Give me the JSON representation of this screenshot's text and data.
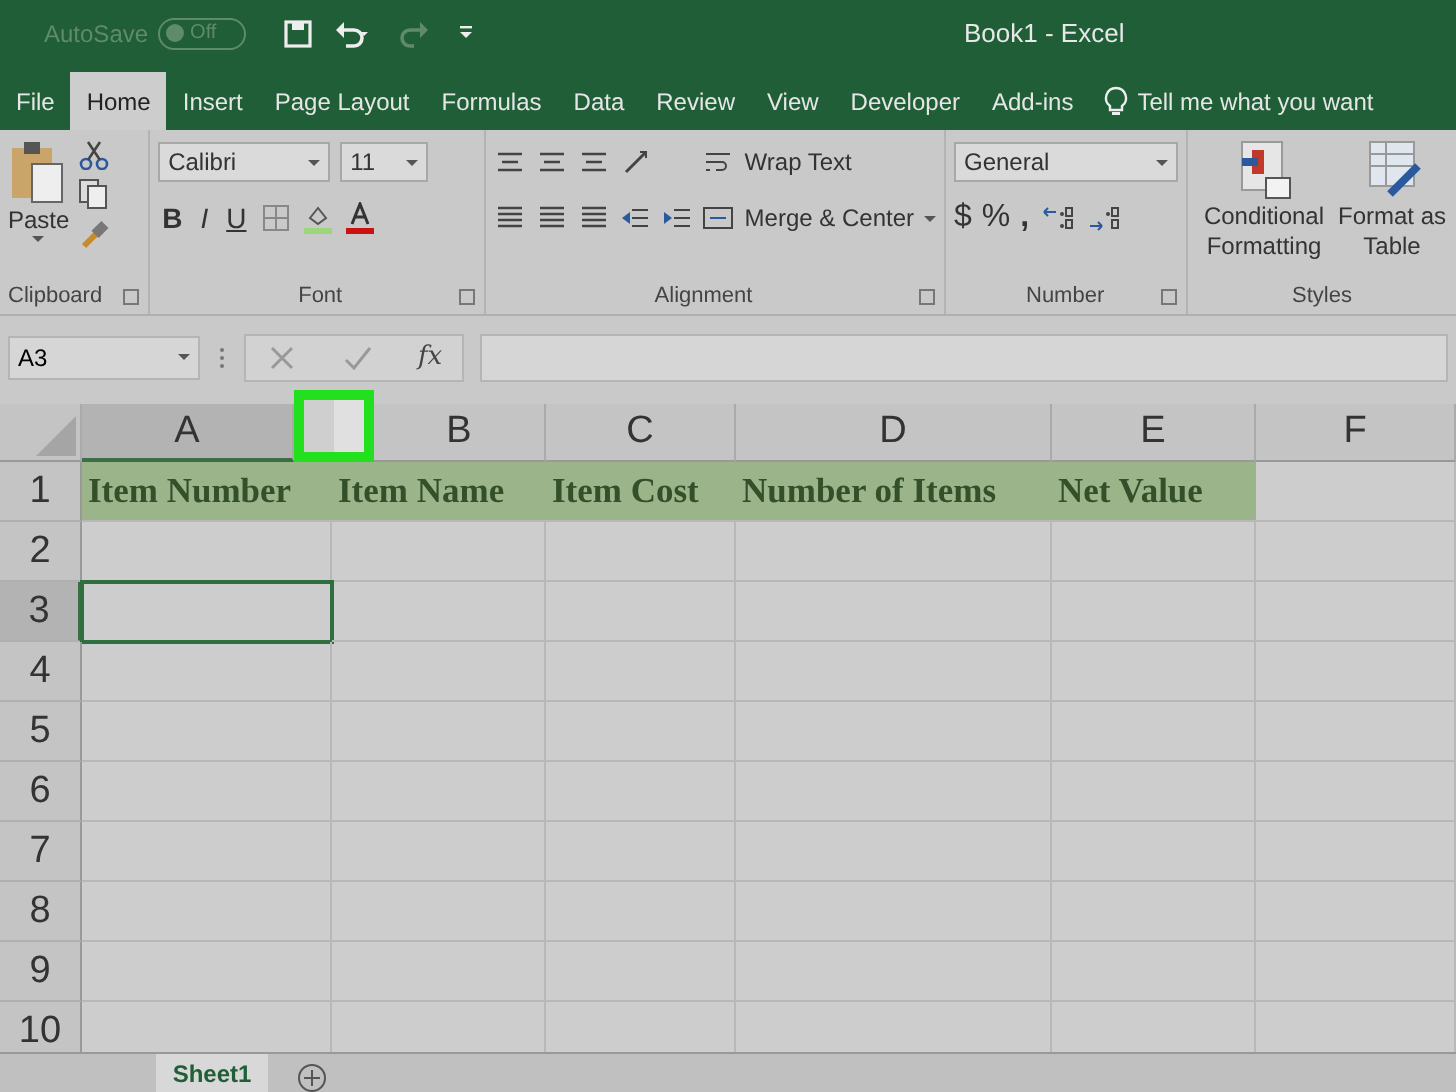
{
  "title_bar": {
    "autosave_label": "AutoSave",
    "autosave_toggle": {
      "label": "Off",
      "on": false
    },
    "title": "Book1  -  Excel"
  },
  "tabs": [
    {
      "label": "File",
      "selected": false
    },
    {
      "label": "Home",
      "selected": true
    },
    {
      "label": "Insert",
      "selected": false
    },
    {
      "label": "Page Layout",
      "selected": false
    },
    {
      "label": "Formulas",
      "selected": false
    },
    {
      "label": "Data",
      "selected": false
    },
    {
      "label": "Review",
      "selected": false
    },
    {
      "label": "View",
      "selected": false
    },
    {
      "label": "Developer",
      "selected": false
    },
    {
      "label": "Add-ins",
      "selected": false
    }
  ],
  "tell_me": "Tell me what you want",
  "ribbon": {
    "clipboard": {
      "paste": "Paste",
      "label": "Clipboard"
    },
    "font": {
      "font_name": "Calibri",
      "font_size": "11",
      "bold": "B",
      "italic": "I",
      "underline": "U",
      "label": "Font"
    },
    "alignment": {
      "wrap_text": "Wrap Text",
      "merge_center": "Merge & Center",
      "label": "Alignment"
    },
    "number": {
      "format": "General",
      "currency": "$",
      "percent": "%",
      "comma": ",",
      "label": "Number"
    },
    "styles": {
      "conditional": "Conditional Formatting",
      "format_table": "Format as Table",
      "label": "Styles"
    }
  },
  "formula_bar": {
    "name_box": "A3",
    "fx": "fx"
  },
  "columns": [
    {
      "label": "A",
      "selected": true
    },
    {
      "label": "B",
      "selected": false
    },
    {
      "label": "C",
      "selected": false
    },
    {
      "label": "D",
      "selected": false
    },
    {
      "label": "E",
      "selected": false
    },
    {
      "label": "F",
      "selected": false
    }
  ],
  "rows": [
    {
      "number": "1",
      "selected": false,
      "cells": [
        "Item Number",
        "Item Name",
        "Item Cost",
        "Number of Items",
        "Net Value"
      ]
    },
    {
      "number": "2",
      "selected": false
    },
    {
      "number": "3",
      "selected": true
    },
    {
      "number": "4",
      "selected": false
    },
    {
      "number": "5",
      "selected": false
    },
    {
      "number": "6",
      "selected": false
    },
    {
      "number": "7",
      "selected": false
    },
    {
      "number": "8",
      "selected": false
    },
    {
      "number": "9",
      "selected": false
    },
    {
      "number": "10",
      "selected": false
    }
  ],
  "sheet_tabs": [
    {
      "label": "Sheet1",
      "selected": true
    }
  ]
}
